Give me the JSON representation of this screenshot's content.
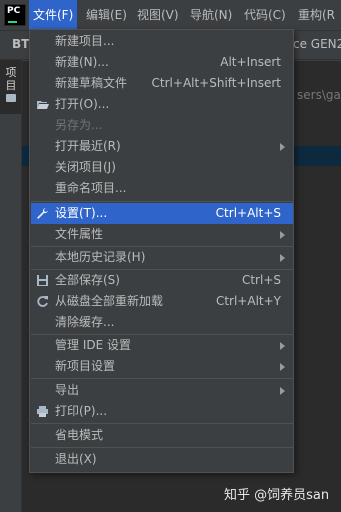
{
  "app": {
    "logo_text": "PC"
  },
  "menubar": {
    "items": [
      {
        "label": "文件(F)",
        "active": true
      },
      {
        "label": "编辑(E)"
      },
      {
        "label": "视图(V)"
      },
      {
        "label": "导航(N)"
      },
      {
        "label": "代码(C)"
      },
      {
        "label": "重构(R"
      }
    ]
  },
  "background": {
    "project_short": "BT",
    "right_fragment": "ce GEN2",
    "path_fragment": "sers\\gao",
    "project_tab_label": "项目"
  },
  "file_menu": {
    "items": [
      {
        "label": "新建项目...",
        "shortcut": ""
      },
      {
        "label": "新建(N)...",
        "shortcut": "Alt+Insert"
      },
      {
        "label": "新建草稿文件",
        "shortcut": "Ctrl+Alt+Shift+Insert"
      },
      {
        "label": "打开(O)...",
        "shortcut": "",
        "icon": "folder-open-icon"
      },
      {
        "label": "另存为...",
        "shortcut": "",
        "disabled": true
      },
      {
        "label": "打开最近(R)",
        "submenu": true
      },
      {
        "label": "关闭项目(J)",
        "shortcut": ""
      },
      {
        "label": "重命名项目...",
        "shortcut": ""
      },
      {
        "label": "设置(T)...",
        "shortcut": "Ctrl+Alt+S",
        "icon": "wrench-icon",
        "highlighted": true
      },
      {
        "label": "文件属性",
        "submenu": true
      },
      {
        "label": "本地历史记录(H)",
        "submenu": true
      },
      {
        "label": "全部保存(S)",
        "shortcut": "Ctrl+S",
        "icon": "save-icon"
      },
      {
        "label": "从磁盘全部重新加载",
        "shortcut": "Ctrl+Alt+Y",
        "icon": "reload-icon"
      },
      {
        "label": "清除缓存...",
        "shortcut": ""
      },
      {
        "label": "管理 IDE 设置",
        "submenu": true
      },
      {
        "label": "新项目设置",
        "submenu": true
      },
      {
        "label": "导出",
        "submenu": true
      },
      {
        "label": "打印(P)...",
        "shortcut": "",
        "icon": "print-icon"
      },
      {
        "label": "省电模式",
        "shortcut": ""
      },
      {
        "label": "退出(X)",
        "shortcut": ""
      }
    ]
  },
  "watermark": "知乎 @饲养员san",
  "colors": {
    "menu_bg": "#3c3f41",
    "highlight": "#2f65ca",
    "editor_bg": "#2b2b2b",
    "text": "#bbbbbb",
    "disabled_text": "#727272"
  }
}
